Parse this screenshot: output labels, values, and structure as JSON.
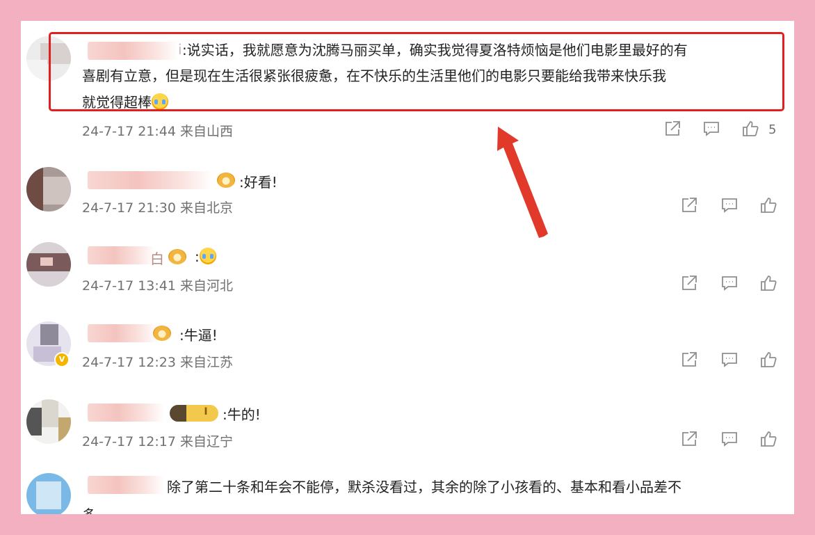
{
  "accent_colors": {
    "highlight_box": "#e02020",
    "arrow": "#e23a2a",
    "frame": "#f2b0c0"
  },
  "comments": [
    {
      "name_suffix": "i",
      "text_lines": [
        "说实话，我就愿意为沈腾马丽买单，确实我觉得夏洛特烦恼是他们电影里最好的有",
        "喜剧有立意，但是现在生活很紧张很疲惫，在不快乐的生活里他们的电影只要能给我带来快乐我",
        "就觉得超棒"
      ],
      "emoji": "crying-face-emoji",
      "date": "24-7-17",
      "time": "21:44",
      "location": "来自山西",
      "likes": "5",
      "highlighted": true
    },
    {
      "text": ":好看!",
      "date": "24-7-17",
      "time": "21:30",
      "location": "来自北京",
      "badge": "medal-badge-icon"
    },
    {
      "name_suffix": "白",
      "text": ":",
      "date": "24-7-17",
      "time": "13:41",
      "location": "来自河北",
      "badge": "medal-badge-icon",
      "emoji": "crying-face-emoji"
    },
    {
      "text": ":牛逼!",
      "date": "24-7-17",
      "time": "12:23",
      "location": "来自江苏",
      "badge": "medal-badge-icon",
      "verified": true
    },
    {
      "badge_text": "I",
      "text": ":牛的!",
      "date": "24-7-17",
      "time": "12:17",
      "location": "来自辽宁",
      "badge": "level-badge-icon"
    },
    {
      "text_lines": [
        "除了第二十条和年会不能停，默杀没看过，其余的除了小孩看的、基本和看小品差不",
        "多"
      ]
    }
  ],
  "icons": {
    "share": "share-icon",
    "reply": "comment-icon",
    "like": "thumbs-up-icon"
  }
}
